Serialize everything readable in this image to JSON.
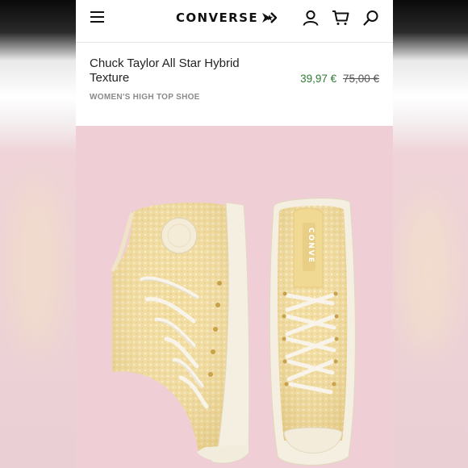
{
  "brand": {
    "name": "CONVERSE"
  },
  "header": {
    "menu_icon": "hamburger-icon",
    "account_icon": "user-icon",
    "cart_icon": "cart-icon",
    "search_icon": "search-icon"
  },
  "product": {
    "title": "Chuck Taylor All Star Hybrid Texture",
    "sale_price": "39,97 €",
    "original_price": "75,00 €",
    "category": "WOMEN'S HIGH TOP SHOE",
    "image_text": "CONVE"
  },
  "colors": {
    "sale_price": "#2e7d32",
    "hero_background": "#efcfd5",
    "shoe_canvas": "#f2dc9e"
  }
}
